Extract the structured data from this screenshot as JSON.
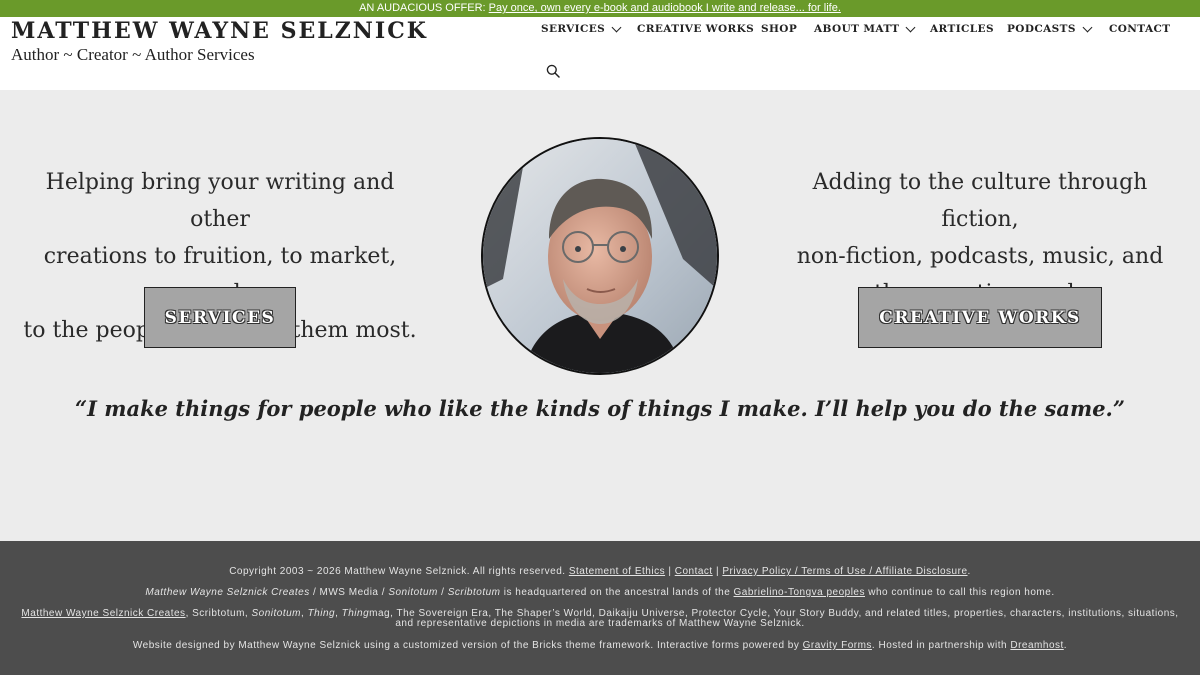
{
  "promo": {
    "lead": "AN AUDACIOUS OFFER: ",
    "link": "Pay once, own every e-book and audiobook I write and release... for life."
  },
  "header": {
    "title": "MATTHEW WAYNE SELZNICK",
    "tagline": "Author ~ Creator ~ Author Services"
  },
  "nav": {
    "services": "SERVICES",
    "creative_works": "CREATIVE WORKS",
    "shop": "SHOP",
    "about": "ABOUT MATT",
    "articles": "ARTICLES",
    "podcasts": "PODCASTS",
    "contact": "CONTACT"
  },
  "hero": {
    "left_lines": [
      "Helping bring your writing and other",
      "creations to fruition, to market, and",
      "to the people who need them most."
    ],
    "right_lines": [
      "Adding to the culture through fiction,",
      "non-fiction, podcasts, music, and",
      "other creative works."
    ],
    "services_button": "SERVICES",
    "creative_button": "CREATIVE WORKS",
    "quote": "“I make things for people who like the kinds of things I make. I’ll help you do the same.”"
  },
  "footer": {
    "l1": {
      "copyright": "Copyright 2003 ~ 2026 Matthew Wayne Selznick. All rights reserved. ",
      "ethics": "Statement of Ethics",
      "sep1": " | ",
      "contact": "Contact",
      "sep2": " | ",
      "privacy": "Privacy Policy / Terms of Use / Affiliate Disclosure",
      "end": "."
    },
    "l2": {
      "creates": "Matthew Wayne Selznick Creates",
      "sep1": " / MWS Media / ",
      "sonitotum": "Sonitotum",
      "sep2": " / ",
      "scribtotum": "Scribtotum",
      "mid": " is headquartered on the ancestral lands of the ",
      "peoples": "Gabrielino-Tongva peoples",
      "end": " who continue to call this region home."
    },
    "l3": {
      "creates_link": "Matthew Wayne Selznick Creates",
      "a": ", Scribtotum, ",
      "sonitotum": "Sonitotum",
      "b": ", ",
      "thing": "Thing",
      "c": ", ",
      "thingmag": "Thing",
      "d": "mag, The Sovereign Era, The Shaper’s World, Daikaiju Universe, Protector Cycle, Your Story Buddy, and related titles, properties, characters, institutions, situations,",
      "line2": "and representative depictions in media are trademarks of Matthew Wayne Selznick."
    },
    "l4": {
      "a": "Website designed by Matthew Wayne Selznick using a customized version of the Bricks theme framework. Interactive forms powered by ",
      "gravity": "Gravity Forms",
      "b": ". Hosted in partnership with ",
      "dreamhost": "Dreamhost",
      "c": "."
    }
  }
}
